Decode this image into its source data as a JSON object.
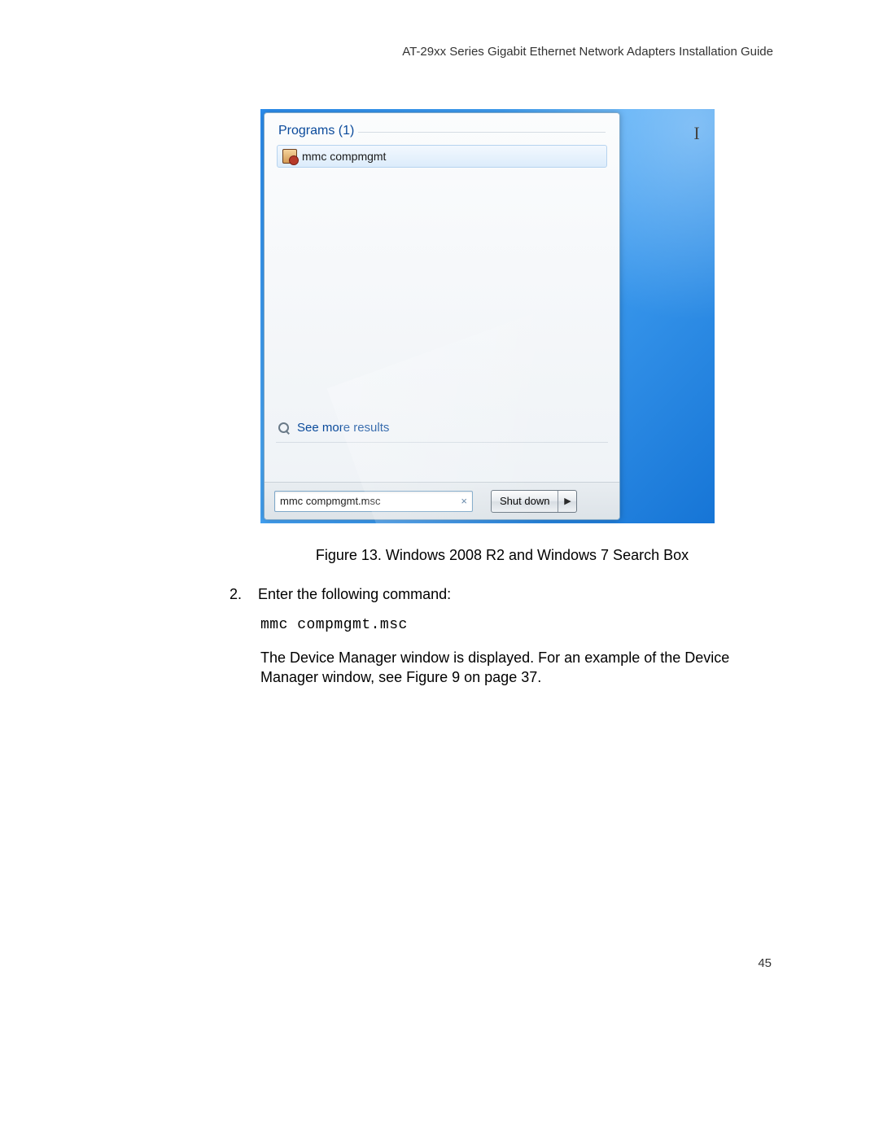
{
  "header": "AT-29xx Series Gigabit Ethernet Network Adapters Installation Guide",
  "page_number": "45",
  "startmenu": {
    "group_label": "Programs (1)",
    "result_label": "mmc compmgmt",
    "see_more": "See more results",
    "search_value": "mmc compmgmt.msc",
    "shutdown_label": "Shut down"
  },
  "caption": "Figure 13. Windows 2008 R2 and Windows 7 Search Box",
  "step2_num": "2.",
  "step2_text": "Enter the following command:",
  "command": "mmc compmgmt.msc",
  "paragraph": "The Device Manager window is displayed. For an example of the Device Manager window, see Figure 9 on page 37."
}
